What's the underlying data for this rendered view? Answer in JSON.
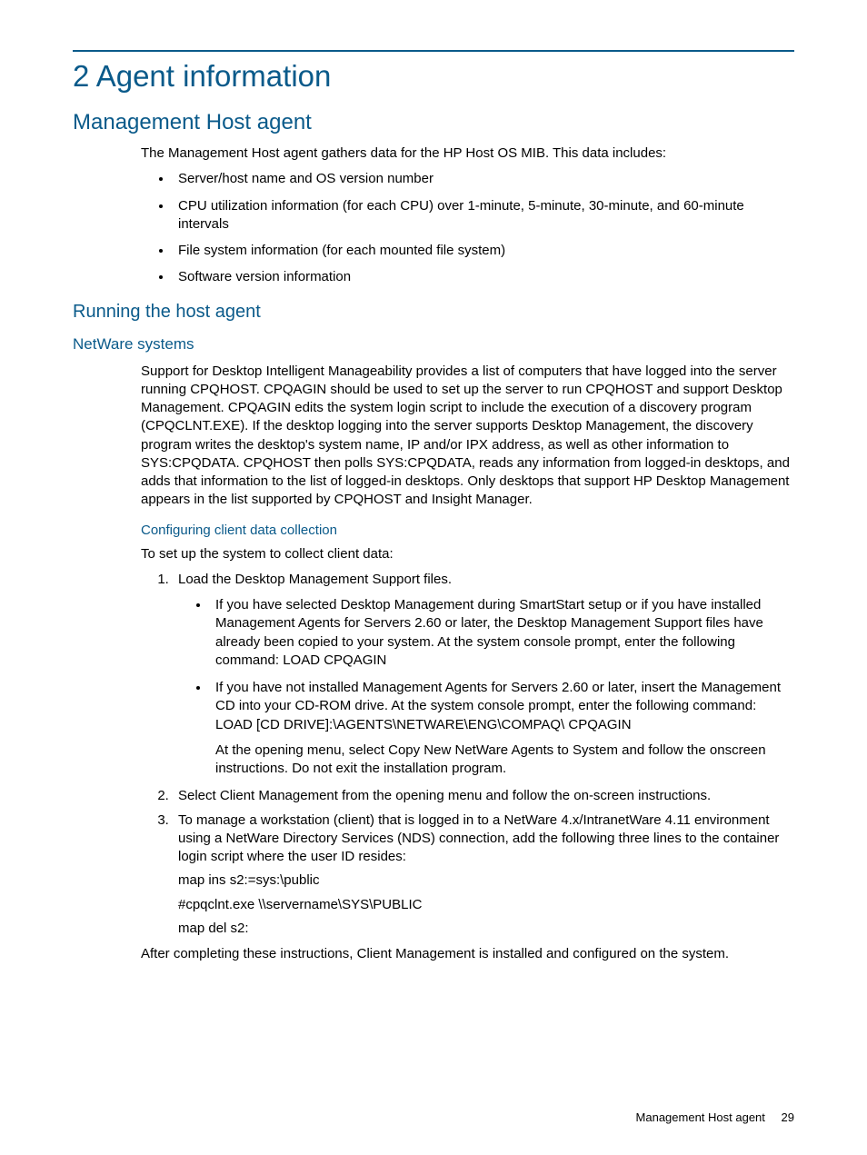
{
  "h1": "2 Agent information",
  "h2": "Management Host agent",
  "p1": "The Management Host agent gathers data for the HP Host OS MIB. This data includes:",
  "bullets1": {
    "b1": "Server/host name and OS version number",
    "b2": "CPU utilization information (for each CPU) over 1-minute, 5-minute, 30-minute, and 60-minute intervals",
    "b3": "File system information (for each mounted file system)",
    "b4": "Software version information"
  },
  "h3": "Running the host agent",
  "h4": "NetWare systems",
  "p2": "Support for Desktop Intelligent Manageability provides a list of computers that have logged into the server running CPQHOST. CPQAGIN should be used to set up the server to run CPQHOST and support Desktop Management. CPQAGIN edits the system login script to include the execution of a discovery program (CPQCLNT.EXE). If the desktop logging into the server supports Desktop Management, the discovery program writes the desktop's system name, IP and/or IPX address, as well as other information to SYS:CPQDATA. CPQHOST then polls SYS:CPQDATA, reads any information from logged-in desktops, and adds that information to the list of logged-in desktops. Only desktops that support HP Desktop Management appears in the list supported by CPQHOST and Insight Manager.",
  "h5": "Configuring client data collection",
  "p3": "To set up the system to collect client data:",
  "ol": {
    "n1": "Load the Desktop Management Support files.",
    "n1a": "If you have selected Desktop Management during SmartStart setup or if you have installed Management Agents for Servers 2.60 or later, the Desktop Management Support files have already been copied to your system. At the system console prompt, enter the following command: LOAD CPQAGIN",
    "n1b": "If you have not installed Management Agents for Servers 2.60 or later, insert the Management CD into your CD-ROM drive. At the system console prompt, enter the following command: LOAD [CD DRIVE]:\\AGENTS\\NETWARE\\ENG\\COMPAQ\\ CPQAGIN",
    "n1b_sub": "At the opening menu, select Copy New NetWare Agents to System and follow the onscreen instructions. Do not exit the installation program.",
    "n2": "Select Client Management from the opening menu and follow the on-screen instructions.",
    "n3": "To manage a workstation (client) that is logged in to a NetWare 4.x/IntranetWare 4.11 environment using a NetWare Directory Services (NDS) connection, add the following three lines to the container login script where the user ID resides:",
    "n3a": "map ins s2:=sys:\\public",
    "n3b": "#cpqclnt.exe \\\\servername\\SYS\\PUBLIC",
    "n3c": "map del s2:"
  },
  "p4": "After completing these instructions, Client Management is installed and configured on the system.",
  "footer": {
    "label": "Management Host agent",
    "page": "29"
  }
}
